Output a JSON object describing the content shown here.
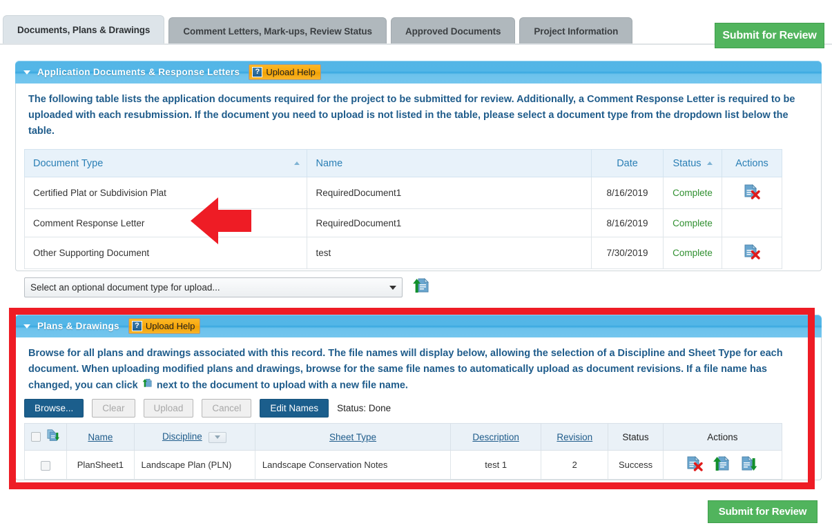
{
  "tabs": [
    {
      "label": "Documents, Plans & Drawings",
      "active": true
    },
    {
      "label": "Comment Letters, Mark-ups, Review Status",
      "active": false
    },
    {
      "label": "Approved Documents",
      "active": false
    },
    {
      "label": "Project Information",
      "active": false
    }
  ],
  "submit_top": {
    "label": "Submit for Review"
  },
  "submit_bottom": {
    "label": "Submit for Review"
  },
  "colors": {
    "accent_blue": "#2a7fb5",
    "panel_blue": "#54b5e6",
    "submit_green": "#51b45d",
    "help_orange": "#f7a80f",
    "annotation_red": "#ee1c25",
    "status_complete": "#2f8f2f",
    "button_primary": "#1b5e8c"
  },
  "documents_panel": {
    "title": "Application Documents & Response Letters",
    "help_badge": {
      "label": "Upload Help",
      "icon": "question-mark-icon",
      "glyph": "?"
    },
    "caret_icon": "caret-down-icon",
    "intro": "The following table lists the application documents required for the project to be submitted for review. Additionally, a Comment Response Letter is required to be uploaded with each resubmission. If the document you need to upload is not listed in the table, please select a document type from the dropdown list below the table.",
    "table": {
      "columns": [
        {
          "label": "Document Type",
          "sort": "asc"
        },
        {
          "label": "Name",
          "sort": ""
        },
        {
          "label": "Date",
          "sort": ""
        },
        {
          "label": "Status",
          "sort": "asc"
        },
        {
          "label": "Actions",
          "sort": ""
        }
      ],
      "rows": [
        {
          "document_type": "Certified Plat or Subdivision Plat",
          "name": "RequiredDocument1",
          "date": "8/16/2019",
          "status": "Complete",
          "has_delete": true
        },
        {
          "document_type": "Comment Response Letter",
          "name": "RequiredDocument1",
          "date": "8/16/2019",
          "status": "Complete",
          "has_delete": false
        },
        {
          "document_type": "Other Supporting Document",
          "name": "test",
          "date": "7/30/2019",
          "status": "Complete",
          "has_delete": true
        }
      ]
    },
    "upload_select": {
      "value": "Select an optional document type for upload...",
      "caret_icon": "chevron-down-icon"
    },
    "upload_icon": "document-upload-icon"
  },
  "plans_panel": {
    "title": "Plans & Drawings",
    "help_badge": {
      "label": "Upload Help",
      "icon": "question-mark-icon",
      "glyph": "?"
    },
    "caret_icon": "caret-down-icon",
    "intro_part1": "Browse for all plans and drawings associated with this record. The file names will display below, allowing the selection of a Discipline and Sheet Type for each document. When uploading modified plans and drawings, browse for the same file names to automatically upload as document revisions. If a file name has changed, you can click",
    "intro_part2": "next to the document to upload with a new file name.",
    "buttons": [
      {
        "label": "Browse...",
        "state": "enabled"
      },
      {
        "label": "Clear",
        "state": "disabled"
      },
      {
        "label": "Upload",
        "state": "disabled"
      },
      {
        "label": "Cancel",
        "state": "disabled"
      },
      {
        "label": "Edit Names",
        "state": "enabled"
      }
    ],
    "status": "Status: Done",
    "table": {
      "columns": [
        {
          "label": "",
          "link": false
        },
        {
          "label": "Name",
          "link": true
        },
        {
          "label": "Discipline",
          "link": true
        },
        {
          "label": "Sheet Type",
          "link": true
        },
        {
          "label": "Description",
          "link": true
        },
        {
          "label": "Revision",
          "link": true
        },
        {
          "label": "Status",
          "link": false
        },
        {
          "label": "Actions",
          "link": false
        }
      ],
      "header_icons": {
        "select_all_checkbox": "checkbox-icon",
        "download_all": "documents-download-icon",
        "discipline_filter": "filter-dropdown-icon"
      },
      "rows": [
        {
          "selected": false,
          "name": "PlanSheet1",
          "discipline": "Landscape Plan (PLN)",
          "sheet_type": "Landscape Conservation Notes",
          "description": "test 1",
          "revision": "2",
          "status": "Success",
          "actions": [
            "document-delete-icon",
            "document-upload-icon",
            "document-download-icon"
          ]
        }
      ]
    }
  },
  "annotations": {
    "arrow": {
      "name": "red-left-arrow",
      "points_to": "Comment Response Letter"
    },
    "highlight_box": {
      "name": "red-highlight-rectangle",
      "surrounds": "Plans & Drawings"
    }
  }
}
